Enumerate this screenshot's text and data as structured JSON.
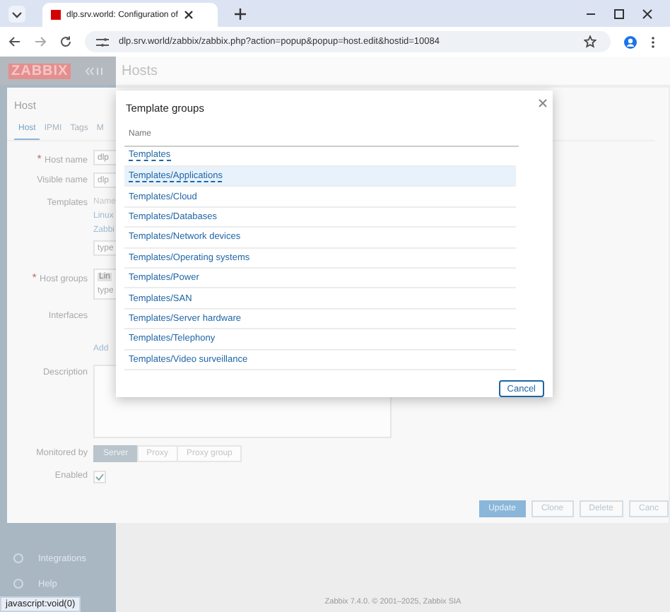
{
  "browser": {
    "tab_title": "dlp.srv.world: Configuration of",
    "url": "dlp.srv.world/zabbix/zabbix.php?action=popup&popup=host.edit&hostid=10084",
    "status_text": "javascript:void(0)"
  },
  "app": {
    "logo": "ZABBIX",
    "page_title": "Hosts",
    "sidebar_items": [
      {
        "label": "Integrations"
      },
      {
        "label": "Help"
      }
    ],
    "footer": "Zabbix 7.4.0. © 2001–2025, Zabbix SIA"
  },
  "host_dialog": {
    "title": "Host",
    "tabs": [
      {
        "label": "Host",
        "selected": true
      },
      {
        "label": "IPMI",
        "selected": false
      },
      {
        "label": "Tags",
        "selected": false
      },
      {
        "label": "M",
        "selected": false
      }
    ],
    "fields": [
      {
        "kind": "input",
        "label": "Host name",
        "required_mark": "*",
        "value": "dlp"
      },
      {
        "kind": "input",
        "label": "Visible name",
        "placeholder": "dlp"
      },
      {
        "kind": "templates",
        "label": "Templates",
        "header": "Name",
        "links": [
          "Linux",
          "Zabbi"
        ],
        "placeholder": "type"
      },
      {
        "kind": "groups",
        "label": "Host groups",
        "required_mark": "*",
        "chip": "Lin",
        "placeholder": "type"
      },
      {
        "kind": "interfaces",
        "label": "Interfaces",
        "link": "Add"
      },
      {
        "kind": "textarea",
        "label": "Description"
      }
    ],
    "monitored_by": {
      "label": "Monitored by",
      "options": [
        {
          "label": "Server",
          "selected": true
        },
        {
          "label": "Proxy",
          "selected": false
        },
        {
          "label": "Proxy group",
          "selected": false
        }
      ]
    },
    "enabled": {
      "label": "Enabled",
      "checked": true
    },
    "buttons": [
      {
        "label": "Update",
        "primary": true
      },
      {
        "label": "Clone",
        "primary": false
      },
      {
        "label": "Delete",
        "primary": false
      },
      {
        "label": "Canc",
        "primary": false
      }
    ]
  },
  "template_groups_popup": {
    "title": "Template groups",
    "column": "Name",
    "rows": [
      {
        "label": "Templates",
        "selected": false
      },
      {
        "label": "Templates/Applications",
        "selected": true
      },
      {
        "label": "Templates/Cloud",
        "selected": false
      },
      {
        "label": "Templates/Databases",
        "selected": false
      },
      {
        "label": "Templates/Network devices",
        "selected": false
      },
      {
        "label": "Templates/Operating systems",
        "selected": false
      },
      {
        "label": "Templates/Power",
        "selected": false
      },
      {
        "label": "Templates/SAN",
        "selected": false
      },
      {
        "label": "Templates/Server hardware",
        "selected": false
      },
      {
        "label": "Templates/Telephony",
        "selected": false
      },
      {
        "label": "Templates/Video surveillance",
        "selected": false
      }
    ],
    "cancel": "Cancel"
  }
}
